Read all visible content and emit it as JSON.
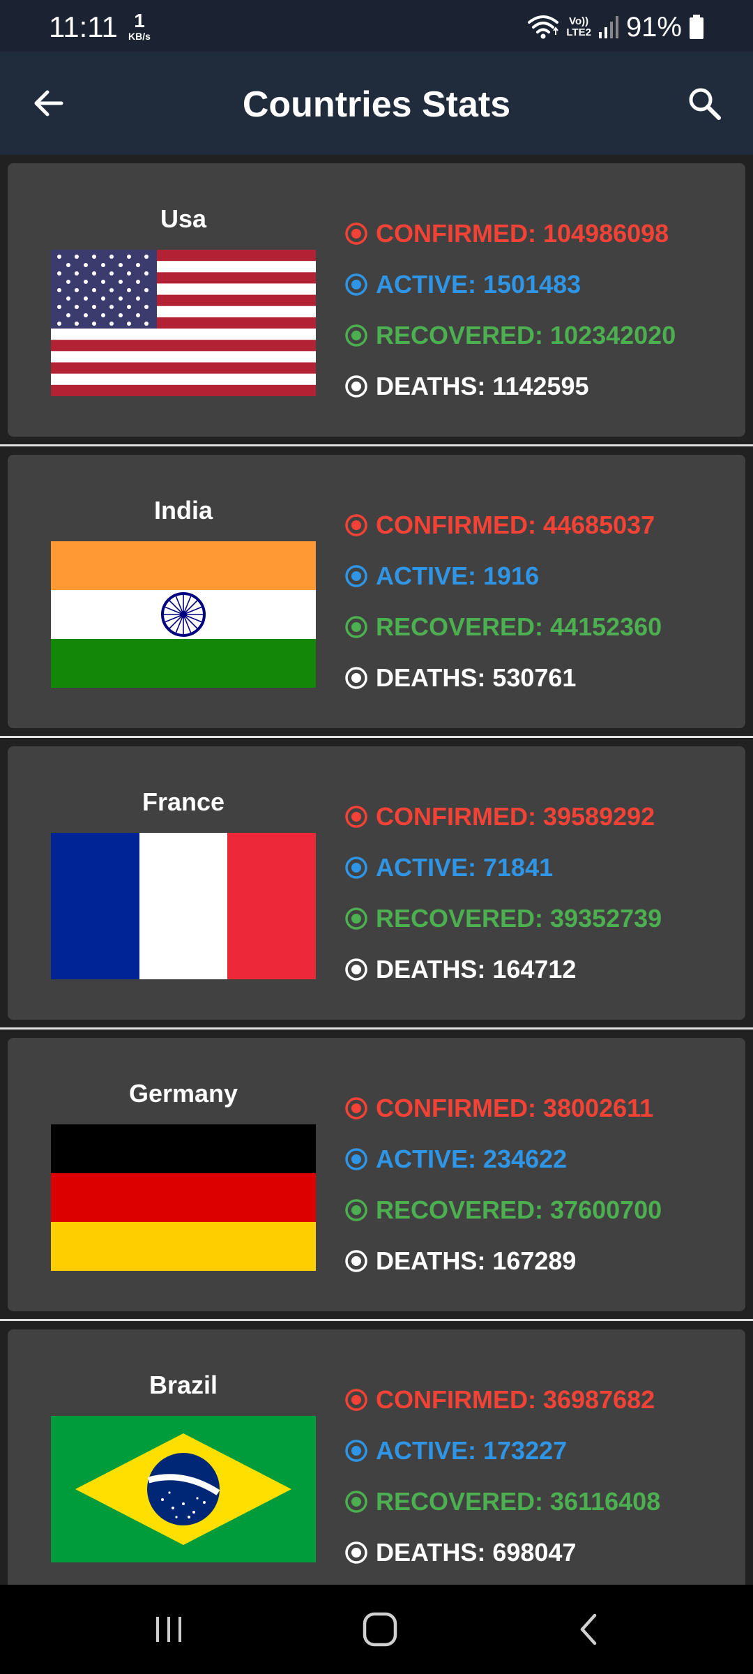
{
  "status_bar": {
    "time": "11:11",
    "speed_value": "1",
    "speed_unit": "KB/s",
    "network_top": "Vo))",
    "network_bottom": "LTE2",
    "battery": "91%"
  },
  "app_bar": {
    "title": "Countries Stats",
    "back_icon": "arrow-left-icon",
    "search_icon": "search-icon"
  },
  "colors": {
    "confirmed": "#f44336",
    "active": "#2f95e6",
    "recovered": "#4caf50",
    "deaths": "#ffffff",
    "card_bg": "#414141",
    "app_bar_bg": "#202b3c"
  },
  "countries": [
    {
      "name": "Usa",
      "flag": "usa-flag",
      "confirmed": "CONFIRMED: 104986098",
      "active": "ACTIVE: 1501483",
      "recovered": "RECOVERED: 102342020",
      "deaths": "DEATHS: 1142595"
    },
    {
      "name": "India",
      "flag": "india-flag",
      "confirmed": "CONFIRMED: 44685037",
      "active": "ACTIVE: 1916",
      "recovered": "RECOVERED: 44152360",
      "deaths": "DEATHS: 530761"
    },
    {
      "name": "France",
      "flag": "france-flag",
      "confirmed": "CONFIRMED: 39589292",
      "active": "ACTIVE: 71841",
      "recovered": "RECOVERED: 39352739",
      "deaths": "DEATHS: 164712"
    },
    {
      "name": "Germany",
      "flag": "germany-flag",
      "confirmed": "CONFIRMED: 38002611",
      "active": "ACTIVE: 234622",
      "recovered": "RECOVERED: 37600700",
      "deaths": "DEATHS: 167289"
    },
    {
      "name": "Brazil",
      "flag": "brazil-flag",
      "confirmed": "CONFIRMED: 36987682",
      "active": "ACTIVE: 173227",
      "recovered": "RECOVERED: 36116408",
      "deaths": "DEATHS: 698047"
    }
  ],
  "nav_bar": {
    "recents_icon": "recents-icon",
    "home_icon": "home-icon",
    "back_icon": "back-icon"
  }
}
